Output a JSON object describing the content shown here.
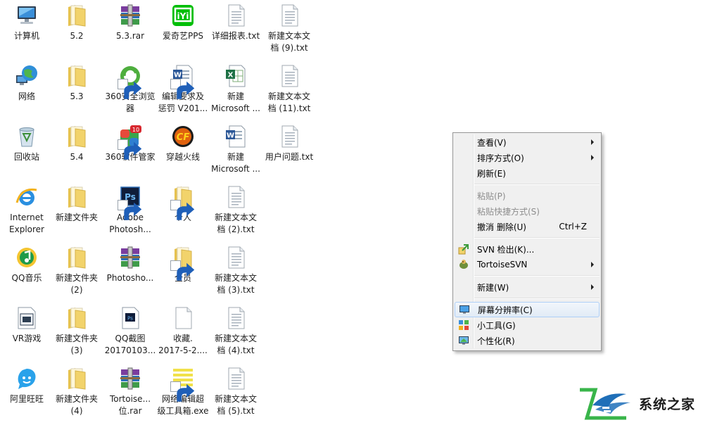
{
  "desktop": {
    "icons": [
      {
        "label": "计算机",
        "icon": "computer-icon",
        "col": 0,
        "row": 0,
        "shortcut": false
      },
      {
        "label": "网络",
        "icon": "network-icon",
        "col": 0,
        "row": 1,
        "shortcut": false
      },
      {
        "label": "回收站",
        "icon": "recycle-bin-icon",
        "col": 0,
        "row": 2,
        "shortcut": false
      },
      {
        "label": "Internet\nExplorer",
        "icon": "internet-explorer-icon",
        "col": 0,
        "row": 3,
        "shortcut": false
      },
      {
        "label": "QQ音乐",
        "icon": "qq-music-icon",
        "col": 0,
        "row": 4,
        "shortcut": false
      },
      {
        "label": "VR游戏",
        "icon": "vr-game-icon",
        "col": 0,
        "row": 5,
        "shortcut": false
      },
      {
        "label": "阿里旺旺",
        "icon": "aliwangwang-icon",
        "col": 0,
        "row": 6,
        "shortcut": false
      },
      {
        "label": "5.2",
        "icon": "folder-icon",
        "col": 1,
        "row": 0,
        "shortcut": false
      },
      {
        "label": "5.3",
        "icon": "folder-icon",
        "col": 1,
        "row": 1,
        "shortcut": false
      },
      {
        "label": "5.4",
        "icon": "folder-icon",
        "col": 1,
        "row": 2,
        "shortcut": false
      },
      {
        "label": "新建文件夹",
        "icon": "folder-icon",
        "col": 1,
        "row": 3,
        "shortcut": false
      },
      {
        "label": "新建文件夹\n(2)",
        "icon": "folder-icon",
        "col": 1,
        "row": 4,
        "shortcut": false
      },
      {
        "label": "新建文件夹\n(3)",
        "icon": "folder-icon",
        "col": 1,
        "row": 5,
        "shortcut": false
      },
      {
        "label": "新建文件夹\n(4)",
        "icon": "folder-icon",
        "col": 1,
        "row": 6,
        "shortcut": false
      },
      {
        "label": "5.3.rar",
        "icon": "winrar-archive-icon",
        "col": 2,
        "row": 0,
        "shortcut": false
      },
      {
        "label": "360安全浏览\n器",
        "icon": "360-browser-icon",
        "col": 2,
        "row": 1,
        "shortcut": true
      },
      {
        "label": "360软件管家",
        "icon": "360-software-manager-icon",
        "col": 2,
        "row": 2,
        "shortcut": true
      },
      {
        "label": "Adobe\nPhotosh...",
        "icon": "photoshop-icon",
        "col": 2,
        "row": 3,
        "shortcut": true
      },
      {
        "label": "Photosho...",
        "icon": "winrar-archive-icon",
        "col": 2,
        "row": 4,
        "shortcut": false
      },
      {
        "label": "QQ截图\n20170103...",
        "icon": "psd-file-icon",
        "col": 2,
        "row": 5,
        "shortcut": false
      },
      {
        "label": "Tortoise...\n位.rar",
        "icon": "winrar-archive-icon",
        "col": 2,
        "row": 6,
        "shortcut": false
      },
      {
        "label": "爱奇艺PPS",
        "icon": "iqiyi-icon",
        "col": 3,
        "row": 0,
        "shortcut": false
      },
      {
        "label": "编辑要求及\n惩罚 V201...",
        "icon": "word-document-icon",
        "col": 3,
        "row": 1,
        "shortcut": true
      },
      {
        "label": "穿越火线",
        "icon": "crossfire-icon",
        "col": 3,
        "row": 2,
        "shortcut": false
      },
      {
        "label": "个人",
        "icon": "folder-icon",
        "col": 3,
        "row": 3,
        "shortcut": true
      },
      {
        "label": "全员",
        "icon": "folder-icon",
        "col": 3,
        "row": 4,
        "shortcut": true
      },
      {
        "label": "收藏.\n2017-5-2....",
        "icon": "blank-file-icon",
        "col": 3,
        "row": 5,
        "shortcut": false
      },
      {
        "label": "网络编辑超\n级工具箱.exe",
        "icon": "toolbox-exe-icon",
        "col": 3,
        "row": 6,
        "shortcut": true
      },
      {
        "label": "详细报表.txt",
        "icon": "text-file-icon",
        "col": 4,
        "row": 0,
        "shortcut": false
      },
      {
        "label": "新建\nMicrosoft ...",
        "icon": "excel-document-icon",
        "col": 4,
        "row": 1,
        "shortcut": false
      },
      {
        "label": "新建\nMicrosoft ...",
        "icon": "word-document-icon",
        "col": 4,
        "row": 2,
        "shortcut": false
      },
      {
        "label": "新建文本文\n档 (2).txt",
        "icon": "text-file-icon",
        "col": 4,
        "row": 3,
        "shortcut": false
      },
      {
        "label": "新建文本文\n档 (3).txt",
        "icon": "text-file-icon",
        "col": 4,
        "row": 4,
        "shortcut": false
      },
      {
        "label": "新建文本文\n档 (4).txt",
        "icon": "text-file-icon",
        "col": 4,
        "row": 5,
        "shortcut": false
      },
      {
        "label": "新建文本文\n档 (5).txt",
        "icon": "text-file-icon",
        "col": 4,
        "row": 6,
        "shortcut": false
      },
      {
        "label": "新建文本文\n档 (9).txt",
        "icon": "text-file-icon",
        "col": 5,
        "row": 0,
        "shortcut": false
      },
      {
        "label": "新建文本文\n档 (11).txt",
        "icon": "text-file-icon",
        "col": 5,
        "row": 1,
        "shortcut": false
      },
      {
        "label": "用户问题.txt",
        "icon": "text-file-icon",
        "col": 5,
        "row": 2,
        "shortcut": false
      }
    ]
  },
  "context_menu": {
    "items": [
      {
        "type": "item",
        "name": "view",
        "label": "查看(V)",
        "submenu": true
      },
      {
        "type": "item",
        "name": "sort-by",
        "label": "排序方式(O)",
        "submenu": true
      },
      {
        "type": "item",
        "name": "refresh",
        "label": "刷新(E)"
      },
      {
        "type": "separator"
      },
      {
        "type": "item",
        "name": "paste",
        "label": "粘贴(P)",
        "disabled": true
      },
      {
        "type": "item",
        "name": "paste-shortcut",
        "label": "粘贴快捷方式(S)",
        "disabled": true
      },
      {
        "type": "item",
        "name": "undo-delete",
        "label": "撤消 删除(U)",
        "shortcut": "Ctrl+Z"
      },
      {
        "type": "separator"
      },
      {
        "type": "item",
        "name": "svn-checkout",
        "label": "SVN 检出(K)...",
        "icon": "svn-checkout-icon"
      },
      {
        "type": "item",
        "name": "tortoisesvn",
        "label": "TortoiseSVN",
        "icon": "tortoisesvn-icon",
        "submenu": true
      },
      {
        "type": "separator"
      },
      {
        "type": "item",
        "name": "new",
        "label": "新建(W)",
        "submenu": true
      },
      {
        "type": "separator"
      },
      {
        "type": "item",
        "name": "screen-resolution",
        "label": "屏幕分辨率(C)",
        "icon": "screen-resolution-icon",
        "hover": true
      },
      {
        "type": "item",
        "name": "gadgets",
        "label": "小工具(G)",
        "icon": "gadgets-icon"
      },
      {
        "type": "item",
        "name": "personalize",
        "label": "个性化(R)",
        "icon": "personalize-icon"
      }
    ]
  },
  "watermark": {
    "text": "系统之家",
    "icon": "xitongzhijia-logo-icon"
  },
  "colors": {
    "folder": "#f2d36b",
    "menu_bg": "#f0f0f0",
    "menu_hover_border": "#aecff7",
    "watermark_green": "#39b54a",
    "watermark_blue": "#1f6fb8"
  }
}
